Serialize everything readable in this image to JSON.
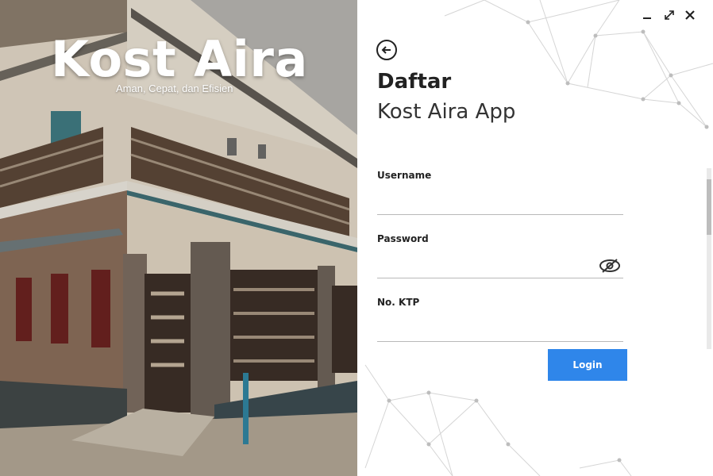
{
  "hero": {
    "title": "Kost Aira",
    "subtitle": "Aman, Cepat, dan Efisien"
  },
  "window": {
    "icons": [
      "minimize-icon",
      "maximize-icon",
      "close-icon"
    ]
  },
  "form": {
    "back_icon": "back-arrow-icon",
    "heading": "Daftar",
    "subheading": "Kost Aira App",
    "fields": [
      {
        "label": "Username",
        "value": ""
      },
      {
        "label": "Password",
        "value": "",
        "icon": "eye-icon"
      },
      {
        "label": "No. KTP",
        "value": ""
      }
    ],
    "submit_label": "Login"
  },
  "colors": {
    "accent": "#2f86ea",
    "text": "#222222",
    "underline": "#b9b9b9"
  }
}
